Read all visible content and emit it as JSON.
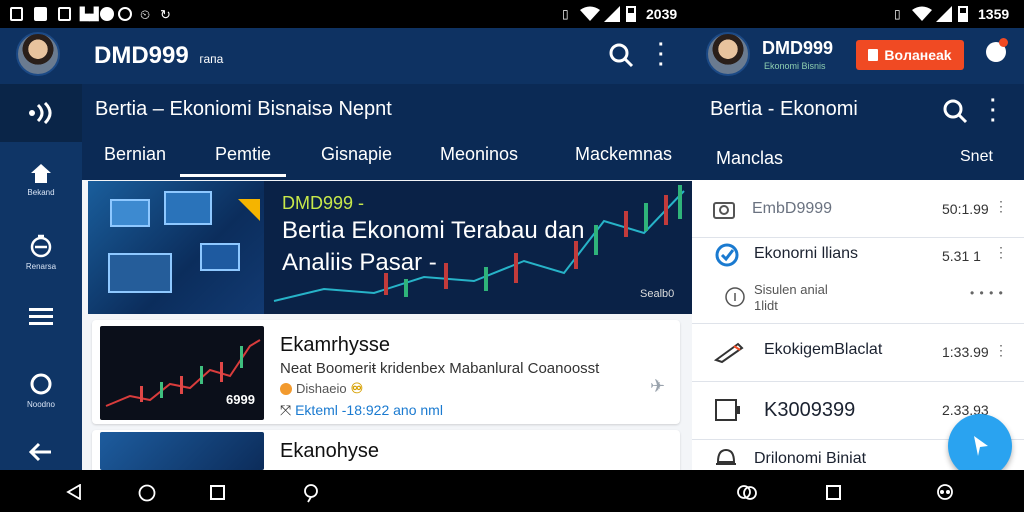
{
  "status_bar": {
    "time_left": "2039",
    "time_right": "1359"
  },
  "header": {
    "brand": "DMD999",
    "brand_suffix": "гапа",
    "brand_right": "DMD999",
    "brand_right_sub": "Ekonomi Bisnis",
    "red_button": "Boлaнеаk"
  },
  "subtitle_left": "Bertia –  Ekoniomi Bisnaisə  Nepnt",
  "subtitle_right": "Bertia - Ekonomi",
  "rail": [
    {
      "icon": "home-icon",
      "label": "Bekand"
    },
    {
      "icon": "timer-icon",
      "label": "Renarsa"
    },
    {
      "icon": "menu-icon",
      "label": ""
    },
    {
      "icon": "circle-icon",
      "label": "Noodno"
    },
    {
      "icon": "exit-icon",
      "label": ""
    }
  ],
  "tabs": [
    "Bernian",
    "Pemtie",
    "Gisnapie",
    "Meoninos",
    "Mackemnas",
    "Manclas",
    "Snet"
  ],
  "hero": {
    "kicker": "DMD999 -",
    "headline_1": "Bertia Ekonomi Terabau dan",
    "headline_2": "Analiis Pasar -",
    "badge": "Sealb0"
  },
  "cards": [
    {
      "title": "Ekamrhysse",
      "desc": "Neat Boomeriŧ kridenbex Mabanlural Coanoosst",
      "source": "Dishaeio",
      "meta": "Ekteml -18:922 ano nml",
      "thumb_label": "6999"
    },
    {
      "title": "Ekanohyse"
    }
  ],
  "panel_rows": [
    {
      "icon": "camera-icon",
      "text": "EmbD9999",
      "value": "50:1.99"
    },
    {
      "icon": "check-circle-icon",
      "text": "Ekonorni llians",
      "value": "5.31 1"
    },
    {
      "icon": "info-icon",
      "text": "Sisulen anial",
      "text2": "1lidt",
      "value": ""
    },
    {
      "icon": "pencil-icon",
      "text": "EkokigemBlaclat",
      "value": "1:33.99"
    },
    {
      "icon": "tablet-icon",
      "text": "K3009399",
      "value": "2.33.93"
    },
    {
      "icon": "bell-icon",
      "text": "Drilonomi Biniat",
      "value": ""
    }
  ],
  "colors": {
    "header": "#0e3262",
    "accent_red": "#f04a23",
    "fab": "#2aa3f0",
    "link": "#1a7ad0"
  }
}
